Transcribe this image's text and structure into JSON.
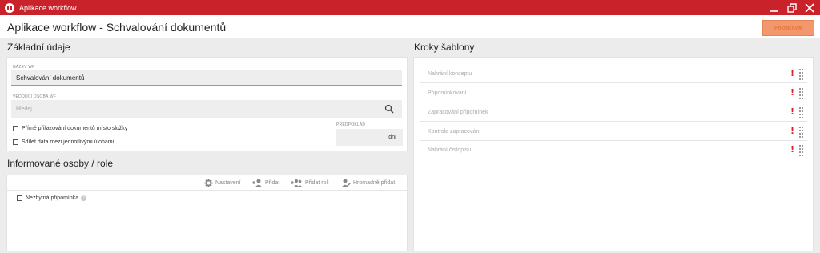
{
  "window": {
    "title": "Aplikace workflow"
  },
  "header": {
    "title": "Aplikace workflow - Schvalování dokumentů",
    "continue_label": "Pokračovat"
  },
  "basic": {
    "title": "Základní údaje",
    "name_label": "Název WF",
    "name_value": "Schvalování dokumentů",
    "lead_label": "Vedoucí osoba WF",
    "lead_placeholder": "Hledej...",
    "direct_assign_label": "Přímé přiřazování dokumentů místo složky",
    "share_data_label": "Sdílet data mezi jednotlivými úlohami",
    "assumption_label": "Předpoklad",
    "assumption_unit": "dní"
  },
  "informed": {
    "title": "Informované osoby / role",
    "toolbar": {
      "settings": "Nastavení",
      "add": "Přidat",
      "add_role": "Přidat roli",
      "bulk_add": "Hromadně přidat"
    },
    "reminder_label": "Nezbytná připomínka"
  },
  "steps": {
    "title": "Kroky šablony",
    "items": [
      {
        "label": "Nahrání konceptu"
      },
      {
        "label": "Připomínkování"
      },
      {
        "label": "Zapracování připomínek"
      },
      {
        "label": "Kontrola zapracování"
      },
      {
        "label": "Nahrání čistopisu"
      }
    ],
    "warning_color": "#e31e24"
  },
  "colors": {
    "brand": "#c9222b",
    "accent": "#f3986c"
  }
}
